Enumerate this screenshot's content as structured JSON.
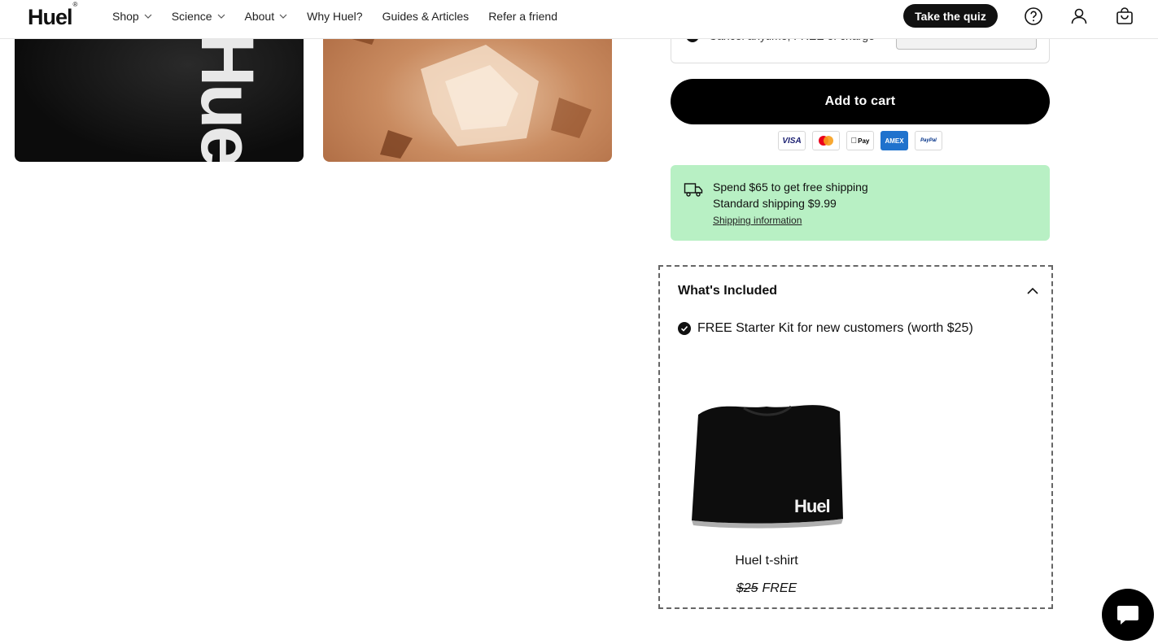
{
  "header": {
    "logo": "Huel",
    "logo_mark": "®",
    "nav": [
      {
        "label": "Shop",
        "has_dropdown": true
      },
      {
        "label": "Science",
        "has_dropdown": true
      },
      {
        "label": "About",
        "has_dropdown": true
      },
      {
        "label": "Why Huel?",
        "has_dropdown": false
      },
      {
        "label": "Guides & Articles",
        "has_dropdown": false
      },
      {
        "label": "Refer a friend",
        "has_dropdown": false
      }
    ],
    "quiz_label": "Take the quiz",
    "icons": [
      "help-icon",
      "account-icon",
      "cart-icon"
    ]
  },
  "subscription": {
    "text": "Cancel anytime, FREE of charge"
  },
  "purchase": {
    "add_to_cart": "Add to cart",
    "payment_methods": [
      {
        "name": "visa",
        "label": "VISA"
      },
      {
        "name": "mastercard",
        "label": ""
      },
      {
        "name": "apple-pay",
        "label": "Pay"
      },
      {
        "name": "amex",
        "label": "AMEX"
      },
      {
        "name": "paypal",
        "label": "PayPal"
      }
    ]
  },
  "shipping": {
    "line1": "Spend $65 to get free shipping",
    "line2": "Standard shipping $9.99",
    "link": "Shipping information",
    "bg_color": "#b8f0c4"
  },
  "included": {
    "title": "What's Included",
    "offer": "FREE Starter Kit for new customers (worth $25)",
    "item": {
      "name": "Huel t-shirt",
      "old_price": "$25",
      "new_price": "FREE",
      "print": "Huel"
    }
  },
  "colors": {
    "primary": "#000000",
    "accent_green": "#b8f0c4"
  }
}
